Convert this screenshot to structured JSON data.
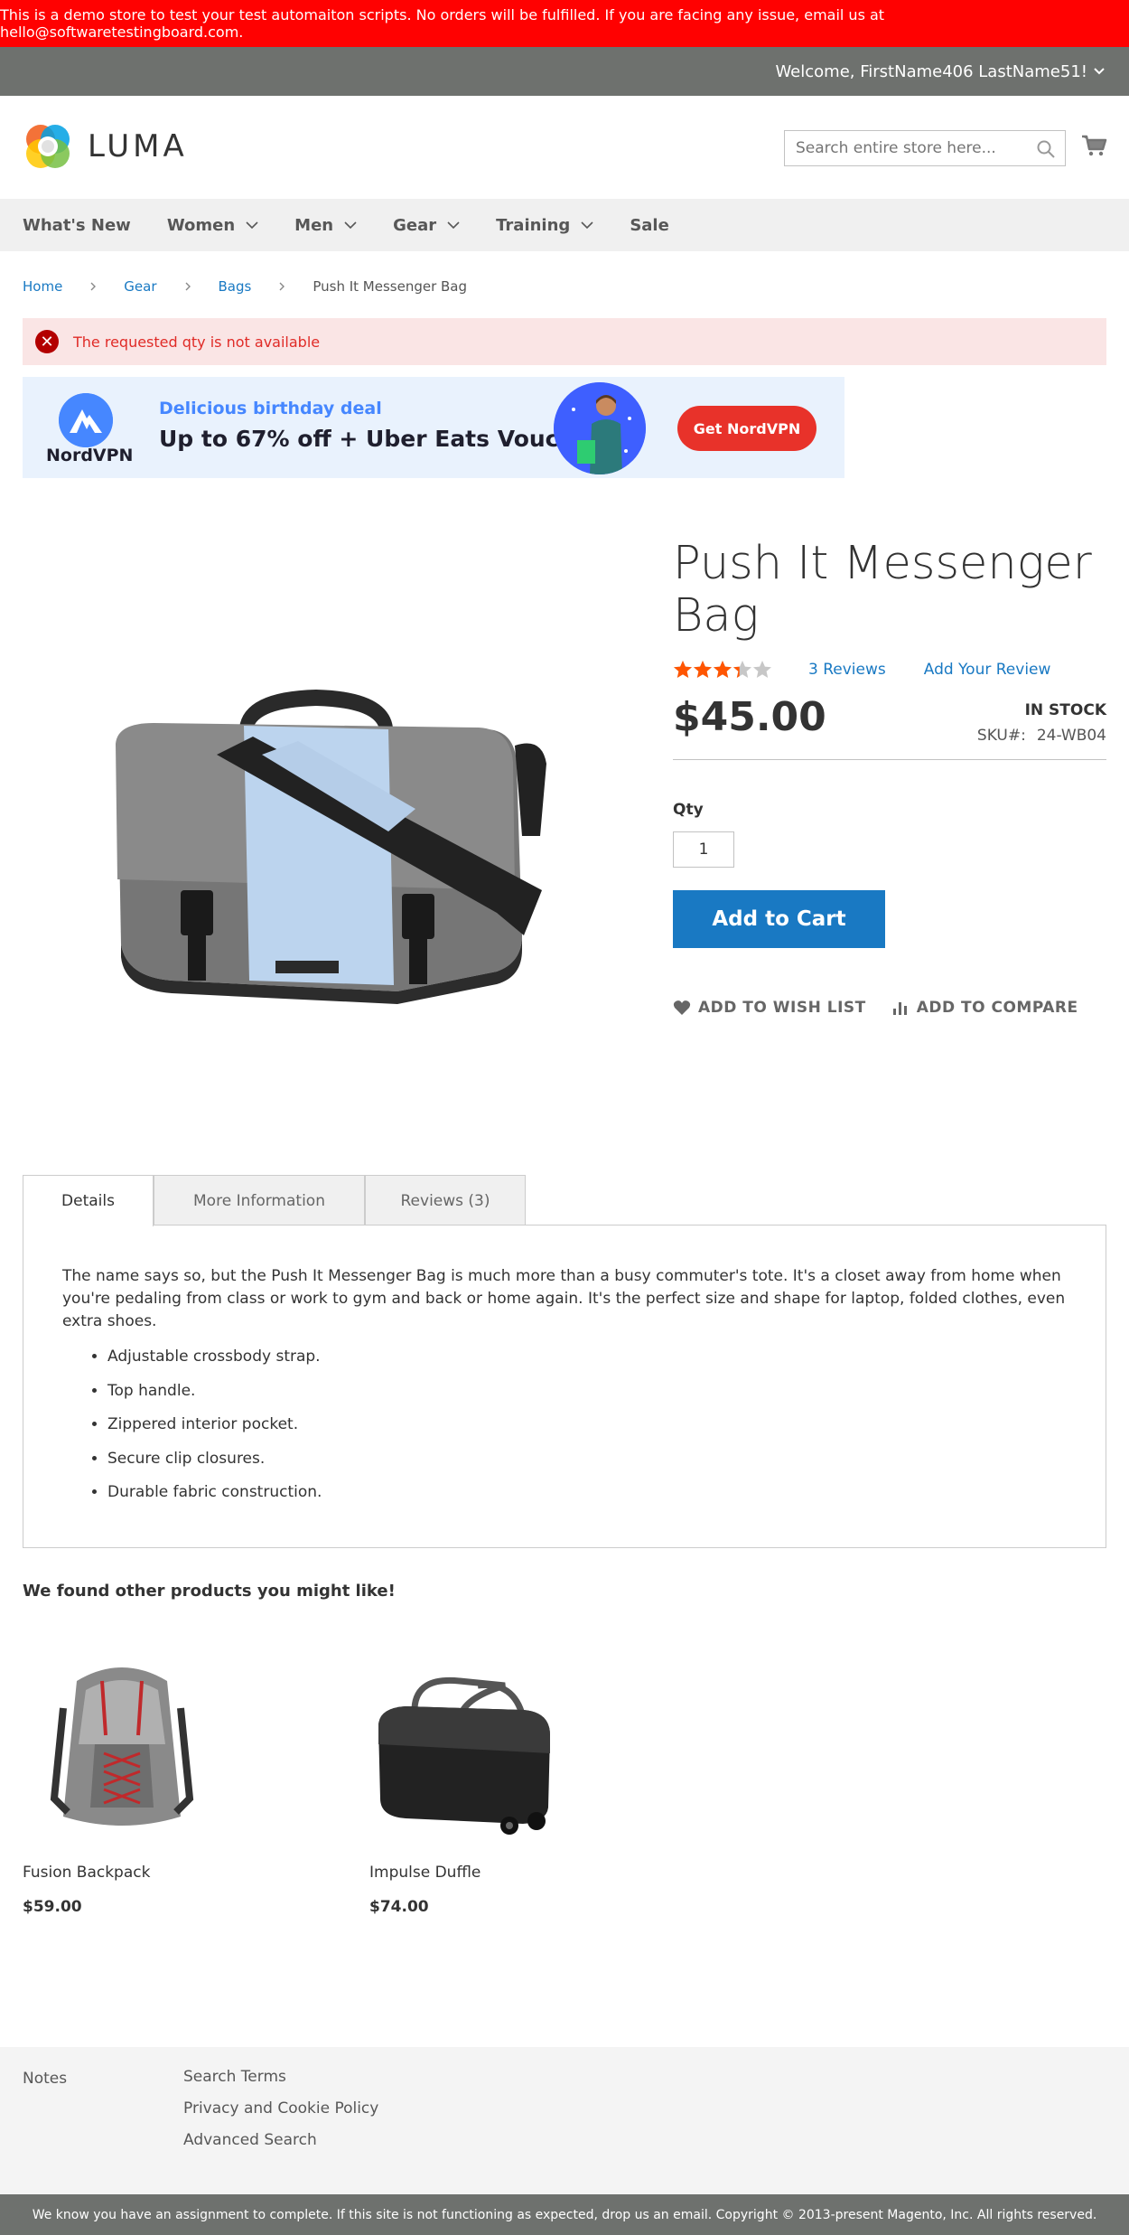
{
  "demo_notice": "This is a demo store to test your test automaiton scripts. No orders will be fulfilled. If you are facing any issue, email us at hello@softwaretestingboard.com.",
  "header": {
    "welcome": "Welcome, FirstName406 LastName51!",
    "logo_text": "LUMA",
    "search_placeholder": "Search entire store here..."
  },
  "nav": {
    "items": [
      {
        "label": "What's New",
        "has_dropdown": false
      },
      {
        "label": "Women",
        "has_dropdown": true
      },
      {
        "label": "Men",
        "has_dropdown": true
      },
      {
        "label": "Gear",
        "has_dropdown": true
      },
      {
        "label": "Training",
        "has_dropdown": true
      },
      {
        "label": "Sale",
        "has_dropdown": false
      }
    ]
  },
  "breadcrumb": {
    "items": [
      "Home",
      "Gear",
      "Bags"
    ],
    "current": "Push It Messenger Bag"
  },
  "error_message": "The requested qty is not available",
  "ad": {
    "brand": "NordVPN",
    "tagline": "Delicious birthday deal",
    "headline": "Up to 67% off + Uber Eats Voucher",
    "button": "Get NordVPN",
    "colors": {
      "brand_blue": "#4687ff",
      "button_red": "#e8322a"
    }
  },
  "product": {
    "title": "Push It Messenger Bag",
    "rating_percent": 67,
    "reviews_link": "3  Reviews",
    "add_review": "Add Your Review",
    "price": "$45.00",
    "stock": "In stock",
    "sku_label": "SKU#:",
    "sku": "24-WB04",
    "qty_label": "Qty",
    "qty_value": "1",
    "add_to_cart": "Add to Cart",
    "wishlist": "Add to Wish List",
    "compare": "Add to Compare"
  },
  "tabs": {
    "items": [
      "Details",
      "More Information",
      "Reviews (3)"
    ],
    "active": "Details",
    "details_text": "The name says so, but the Push It Messenger Bag is much more than a busy commuter's tote. It's a closet away from home when you're pedaling from class or work to gym and back or home again. It's the perfect size and shape for laptop, folded clothes, even extra shoes.",
    "features": [
      "Adjustable crossbody strap.",
      "Top handle.",
      "Zippered interior pocket.",
      "Secure clip closures.",
      "Durable fabric construction."
    ]
  },
  "related": {
    "title": "We found other products you might like!",
    "products": [
      {
        "name": "Fusion Backpack",
        "price": "$59.00"
      },
      {
        "name": "Impulse Duffle",
        "price": "$74.00"
      }
    ]
  },
  "footer": {
    "col1": [
      "Notes"
    ],
    "col2": [
      "Search Terms",
      "Privacy and Cookie Policy",
      "Advanced Search"
    ],
    "copyright": "We know you have an assignment to complete. If this site is not functioning as expected, drop us an email. Copyright © 2013-present Magento, Inc. All rights reserved."
  },
  "colors": {
    "demo_bar": "#ff0101",
    "top_bar": "#6e716e",
    "link": "#1979c3",
    "primary_button": "#1979c3",
    "star": "#ff5501",
    "error_bg": "#fae5e5",
    "error_text": "#e02b27"
  }
}
